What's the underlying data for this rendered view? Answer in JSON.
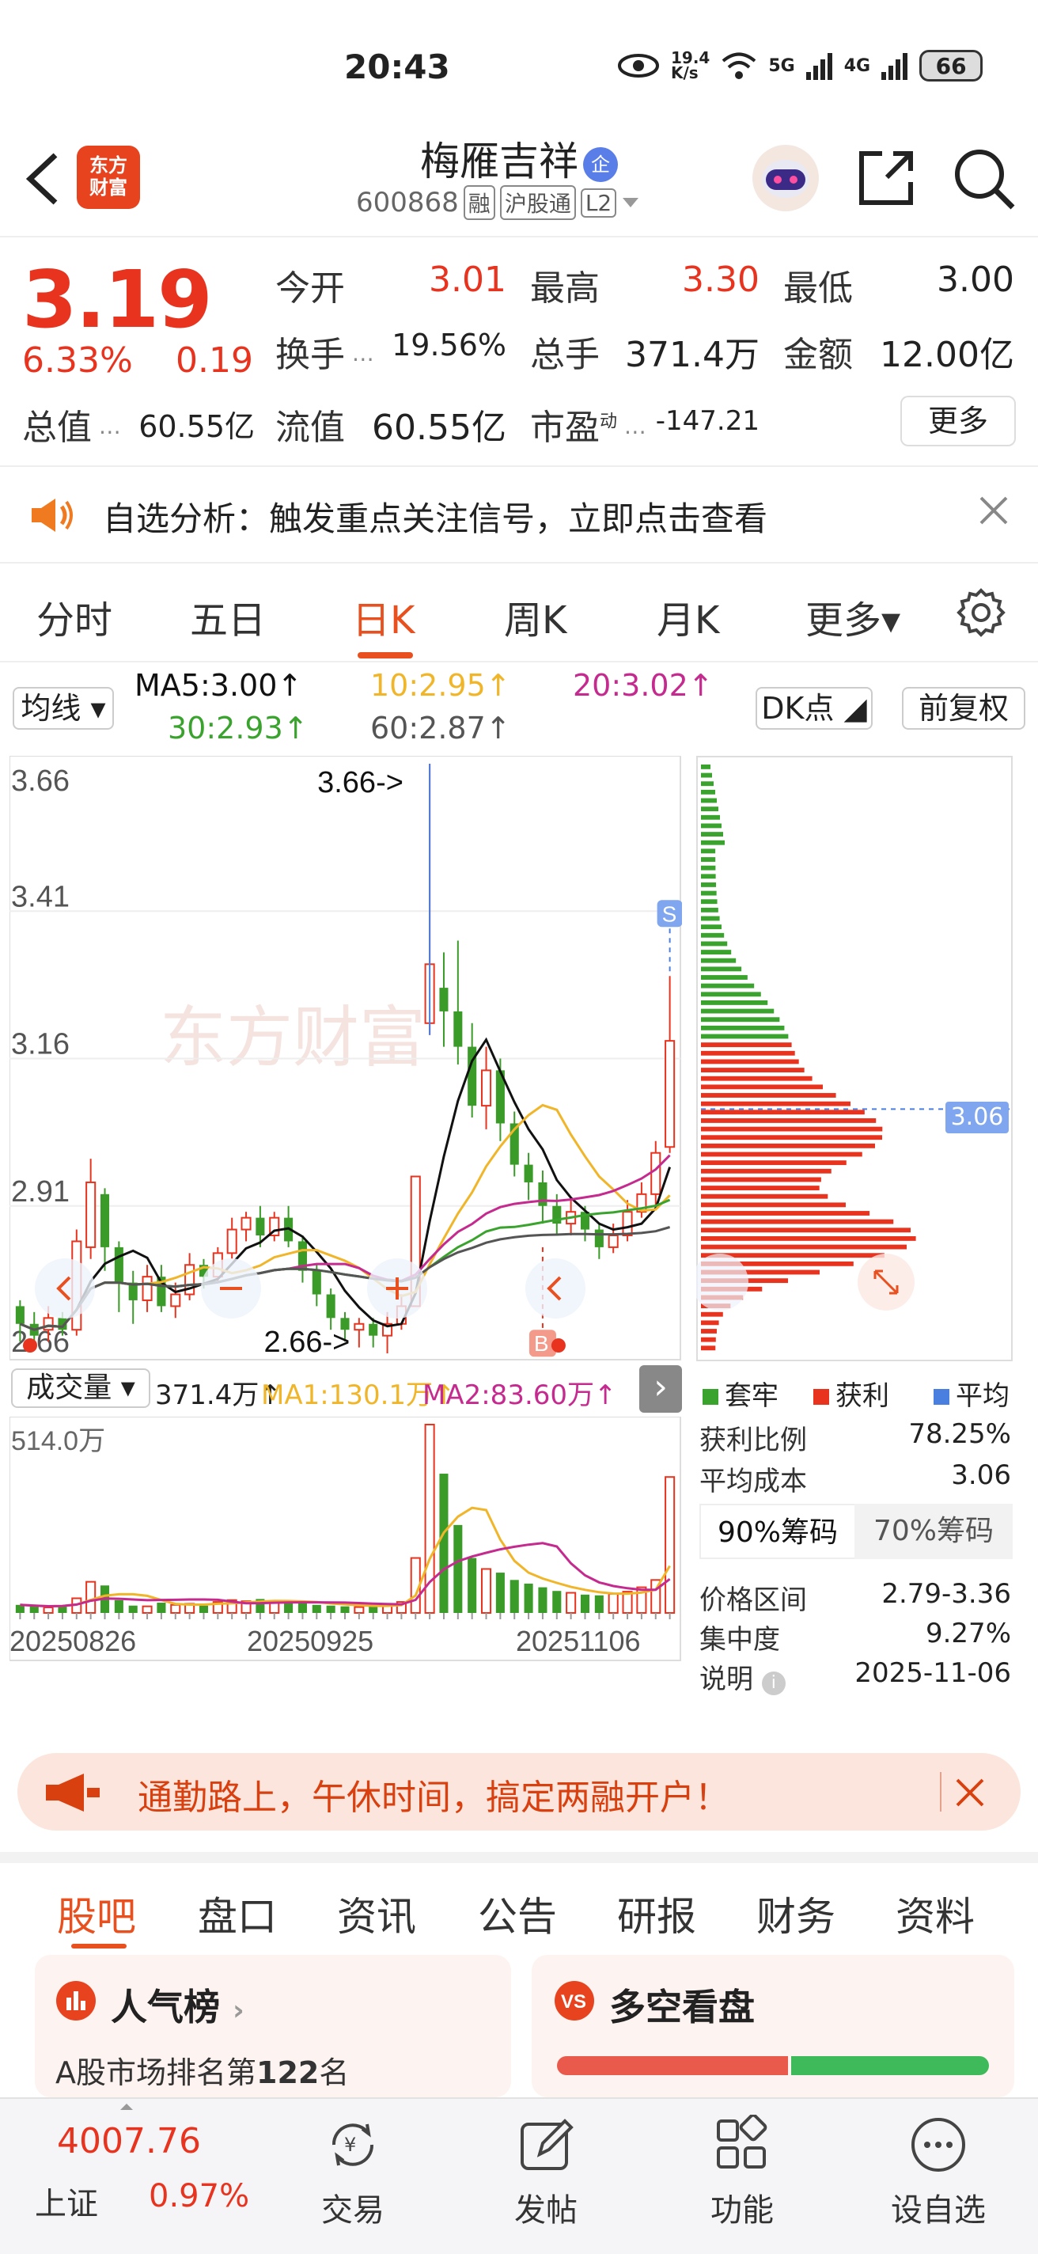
{
  "status_bar": {
    "time": "20:43",
    "net_speed": "19.4\nK/s",
    "signal1": "5G",
    "signal2": "4G",
    "battery": "66"
  },
  "header": {
    "back_icon": "chevron-left-icon",
    "logo_line1": "东方",
    "logo_line2": "财富",
    "stock_name": "梅雁吉祥",
    "qi_badge": "企",
    "stock_code": "600868",
    "tag_rong": "融",
    "tag_hgt": "沪股通",
    "tag_l2": "L2"
  },
  "quote": {
    "price": "3.19",
    "change_pct": "6.33%",
    "change_amt": "0.19",
    "open_label": "今开",
    "open_value": "3.01",
    "high_label": "最高",
    "high_value": "3.30",
    "low_label": "最低",
    "low_value": "3.00",
    "turnover_label": "换手",
    "turnover_value": "19.56%",
    "volume_label": "总手",
    "volume_value": "371.4万",
    "amount_label": "金额",
    "amount_value": "12.00亿",
    "mktcap_label": "总值",
    "mktcap_value": "60.55亿",
    "float_label": "流值",
    "float_value": "60.55亿",
    "pe_label": "市盈",
    "pe_sup": "动",
    "pe_value": "-147.21",
    "more_label": "更多"
  },
  "notice": {
    "text": "自选分析：触发重点关注信号，立即点击查看"
  },
  "chart_tabs": [
    "分时",
    "五日",
    "日K",
    "周K",
    "月K",
    "更多▾"
  ],
  "active_tab": "日K",
  "ma_row": {
    "ma_button": "均线",
    "ma5": "MA5:3.00↑",
    "ma10": "10:2.95↑",
    "ma20": "20:3.02↑",
    "ma30": "30:2.93↑",
    "ma60": "60:2.87↑",
    "dk_button": "DK点",
    "fq_button": "前复权"
  },
  "colors": {
    "up": "#e8331f",
    "down": "#3a9b28",
    "accent": "#e8501f",
    "ma5": "#111111",
    "ma10": "#f0b528",
    "ma20": "#c52a8f",
    "ma30": "#3aa32e",
    "ma60": "#555555",
    "avg_cost": "#4a7fe0"
  },
  "main_chart": {
    "watermark": "东方财富",
    "max_marker": "3.66->",
    "min_marker": "2.66->",
    "s_marker": "S",
    "b_marker": "B"
  },
  "chip": {
    "avg_tag": "3.06",
    "legend_trapped": "套牢",
    "legend_profit": "获利",
    "legend_avg": "平均",
    "profit_ratio_label": "获利比例",
    "profit_ratio_value": "78.25%",
    "avg_cost_label": "平均成本",
    "avg_cost_value": "3.06",
    "tab90": "90%筹码",
    "tab70": "70%筹码",
    "range_label": "价格区间",
    "range_value": "2.79-3.36",
    "conc_label": "集中度",
    "conc_value": "9.27%",
    "note_label": "说明",
    "note_value": "2025-11-06"
  },
  "volume": {
    "button": "成交量",
    "value": "371.4万↑",
    "ma1": "MA1:130.1万↑",
    "ma2": "MA2:83.60万↑",
    "top_label": "514.0万"
  },
  "chart_data": {
    "type": "candlestick",
    "title": "",
    "y_ticks": [
      "3.66",
      "3.41",
      "3.16",
      "2.91",
      "2.66"
    ],
    "ylim": [
      2.66,
      3.66
    ],
    "x_ticks": [
      "20250826",
      "20250925",
      "20251106"
    ],
    "candles": [
      {
        "o": 2.74,
        "c": 2.71,
        "h": 2.75,
        "l": 2.68
      },
      {
        "o": 2.71,
        "c": 2.69,
        "h": 2.73,
        "l": 2.67
      },
      {
        "o": 2.7,
        "c": 2.72,
        "h": 2.74,
        "l": 2.68
      },
      {
        "o": 2.72,
        "c": 2.7,
        "h": 2.73,
        "l": 2.69
      },
      {
        "o": 2.7,
        "c": 2.85,
        "h": 2.87,
        "l": 2.69
      },
      {
        "o": 2.84,
        "c": 2.95,
        "h": 2.99,
        "l": 2.82
      },
      {
        "o": 2.93,
        "c": 2.84,
        "h": 2.94,
        "l": 2.8
      },
      {
        "o": 2.84,
        "c": 2.78,
        "h": 2.85,
        "l": 2.73
      },
      {
        "o": 2.78,
        "c": 2.75,
        "h": 2.8,
        "l": 2.71
      },
      {
        "o": 2.75,
        "c": 2.79,
        "h": 2.81,
        "l": 2.73
      },
      {
        "o": 2.79,
        "c": 2.74,
        "h": 2.81,
        "l": 2.73
      },
      {
        "o": 2.74,
        "c": 2.76,
        "h": 2.78,
        "l": 2.72
      },
      {
        "o": 2.76,
        "c": 2.81,
        "h": 2.83,
        "l": 2.75
      },
      {
        "o": 2.81,
        "c": 2.79,
        "h": 2.82,
        "l": 2.77
      },
      {
        "o": 2.79,
        "c": 2.83,
        "h": 2.84,
        "l": 2.78
      },
      {
        "o": 2.83,
        "c": 2.87,
        "h": 2.89,
        "l": 2.82
      },
      {
        "o": 2.87,
        "c": 2.89,
        "h": 2.9,
        "l": 2.85
      },
      {
        "o": 2.89,
        "c": 2.86,
        "h": 2.91,
        "l": 2.84
      },
      {
        "o": 2.86,
        "c": 2.89,
        "h": 2.9,
        "l": 2.85
      },
      {
        "o": 2.89,
        "c": 2.85,
        "h": 2.91,
        "l": 2.84
      },
      {
        "o": 2.85,
        "c": 2.8,
        "h": 2.86,
        "l": 2.78
      },
      {
        "o": 2.8,
        "c": 2.76,
        "h": 2.81,
        "l": 2.74
      },
      {
        "o": 2.76,
        "c": 2.72,
        "h": 2.77,
        "l": 2.7
      },
      {
        "o": 2.72,
        "c": 2.7,
        "h": 2.73,
        "l": 2.68
      },
      {
        "o": 2.7,
        "c": 2.71,
        "h": 2.72,
        "l": 2.67
      },
      {
        "o": 2.71,
        "c": 2.69,
        "h": 2.72,
        "l": 2.67
      },
      {
        "o": 2.69,
        "c": 2.71,
        "h": 2.73,
        "l": 2.66
      },
      {
        "o": 2.71,
        "c": 2.74,
        "h": 2.76,
        "l": 2.7
      },
      {
        "o": 2.74,
        "c": 2.96,
        "h": 2.96,
        "l": 2.74
      },
      {
        "o": 3.22,
        "c": 3.32,
        "h": 3.66,
        "l": 3.2
      },
      {
        "o": 3.28,
        "c": 3.24,
        "h": 3.34,
        "l": 3.18
      },
      {
        "o": 3.24,
        "c": 3.18,
        "h": 3.36,
        "l": 3.15
      },
      {
        "o": 3.18,
        "c": 3.08,
        "h": 3.22,
        "l": 3.06
      },
      {
        "o": 3.08,
        "c": 3.14,
        "h": 3.18,
        "l": 3.04
      },
      {
        "o": 3.14,
        "c": 3.05,
        "h": 3.16,
        "l": 3.02
      },
      {
        "o": 3.05,
        "c": 2.98,
        "h": 3.07,
        "l": 2.96
      },
      {
        "o": 2.98,
        "c": 2.95,
        "h": 3.0,
        "l": 2.92
      },
      {
        "o": 2.95,
        "c": 2.91,
        "h": 2.97,
        "l": 2.88
      },
      {
        "o": 2.91,
        "c": 2.88,
        "h": 2.93,
        "l": 2.86
      },
      {
        "o": 2.88,
        "c": 2.9,
        "h": 2.92,
        "l": 2.86
      },
      {
        "o": 2.9,
        "c": 2.87,
        "h": 2.91,
        "l": 2.85
      },
      {
        "o": 2.87,
        "c": 2.84,
        "h": 2.88,
        "l": 2.82
      },
      {
        "o": 2.84,
        "c": 2.86,
        "h": 2.88,
        "l": 2.83
      },
      {
        "o": 2.86,
        "c": 2.9,
        "h": 2.92,
        "l": 2.85
      },
      {
        "o": 2.9,
        "c": 2.93,
        "h": 2.95,
        "l": 2.89
      },
      {
        "o": 2.93,
        "c": 3.0,
        "h": 3.02,
        "l": 2.91
      },
      {
        "o": 3.01,
        "c": 3.19,
        "h": 3.3,
        "l": 3.0
      }
    ],
    "volume_max": 514.0,
    "volumes": [
      22,
      18,
      15,
      20,
      40,
      85,
      75,
      35,
      20,
      18,
      28,
      22,
      25,
      20,
      30,
      35,
      32,
      38,
      30,
      28,
      30,
      22,
      20,
      18,
      16,
      20,
      22,
      30,
      150,
      514,
      380,
      240,
      150,
      120,
      110,
      90,
      80,
      70,
      60,
      55,
      50,
      48,
      52,
      58,
      70,
      90,
      371
    ],
    "chip_rows": 70
  },
  "promo": {
    "text": "通勤路上，午休时间，搞定两融开户！"
  },
  "news_tabs": [
    "股吧",
    "盘口",
    "资讯",
    "公告",
    "研报",
    "财务",
    "资料"
  ],
  "cards": {
    "hot_title": "人气榜",
    "hot_rank_prefix": "A股市场排名第",
    "hot_rank": "122",
    "hot_rank_suffix": "名",
    "vs_title": "多空看盘"
  },
  "bottom_nav": {
    "index_value": "4007.76",
    "index_name": "上证",
    "index_change": "0.97%",
    "items": [
      "交易",
      "发帖",
      "功能",
      "设自选"
    ]
  }
}
